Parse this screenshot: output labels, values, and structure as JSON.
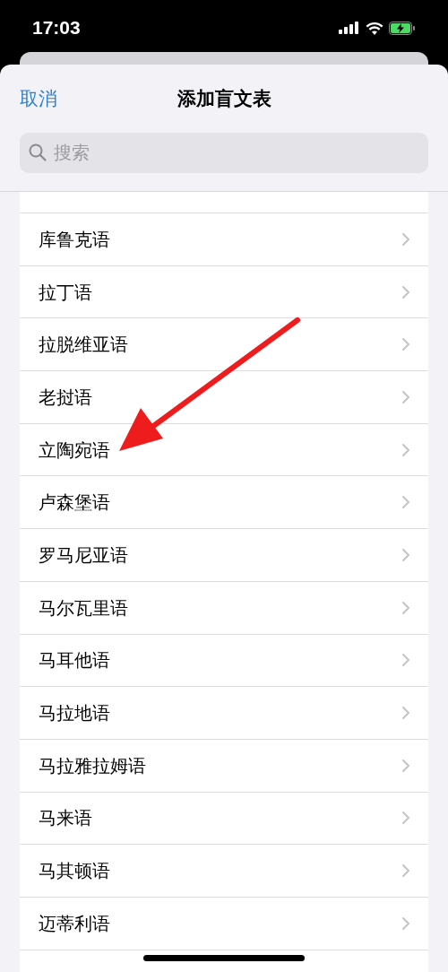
{
  "status_bar": {
    "time": "17:03"
  },
  "header": {
    "cancel": "取消",
    "title": "添加盲文表"
  },
  "search": {
    "placeholder": "搜索"
  },
  "languages": [
    "库鲁克语",
    "拉丁语",
    "拉脱维亚语",
    "老挝语",
    "立陶宛语",
    "卢森堡语",
    "罗马尼亚语",
    "马尔瓦里语",
    "马耳他语",
    "马拉地语",
    "马拉雅拉姆语",
    "马来语",
    "马其顿语",
    "迈蒂利语"
  ]
}
